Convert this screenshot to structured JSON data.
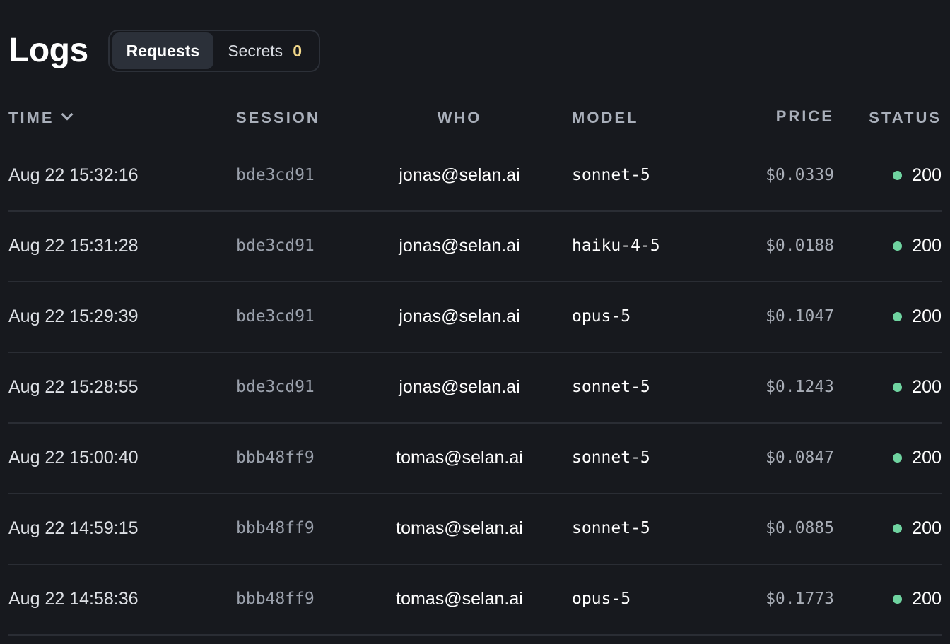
{
  "header": {
    "title": "Logs",
    "tabs": [
      {
        "label": "Requests",
        "active": true
      },
      {
        "label": "Secrets",
        "count": "0",
        "active": false
      }
    ]
  },
  "table": {
    "columns": {
      "time": "TIME",
      "session": "SESSION",
      "who": "WHO",
      "model": "MODEL",
      "price": "PRICE",
      "status": "STATUS"
    },
    "rows": [
      {
        "time": "Aug 22 15:32:16",
        "session": "bde3cd91",
        "who": "jonas@selan.ai",
        "model": "sonnet-5",
        "price": "$0.0339",
        "status": "200"
      },
      {
        "time": "Aug 22 15:31:28",
        "session": "bde3cd91",
        "who": "jonas@selan.ai",
        "model": "haiku-4-5",
        "price": "$0.0188",
        "status": "200"
      },
      {
        "time": "Aug 22 15:29:39",
        "session": "bde3cd91",
        "who": "jonas@selan.ai",
        "model": "opus-5",
        "price": "$0.1047",
        "status": "200"
      },
      {
        "time": "Aug 22 15:28:55",
        "session": "bde3cd91",
        "who": "jonas@selan.ai",
        "model": "sonnet-5",
        "price": "$0.1243",
        "status": "200"
      },
      {
        "time": "Aug 22 15:00:40",
        "session": "bbb48ff9",
        "who": "tomas@selan.ai",
        "model": "sonnet-5",
        "price": "$0.0847",
        "status": "200"
      },
      {
        "time": "Aug 22 14:59:15",
        "session": "bbb48ff9",
        "who": "tomas@selan.ai",
        "model": "sonnet-5",
        "price": "$0.0885",
        "status": "200"
      },
      {
        "time": "Aug 22 14:58:36",
        "session": "bbb48ff9",
        "who": "tomas@selan.ai",
        "model": "opus-5",
        "price": "$0.1773",
        "status": "200"
      }
    ]
  },
  "colors": {
    "background": "#17191e",
    "status_ok": "#6fd3a0",
    "secrets_count": "#f1d78a",
    "active_tab": "#2b3039"
  }
}
